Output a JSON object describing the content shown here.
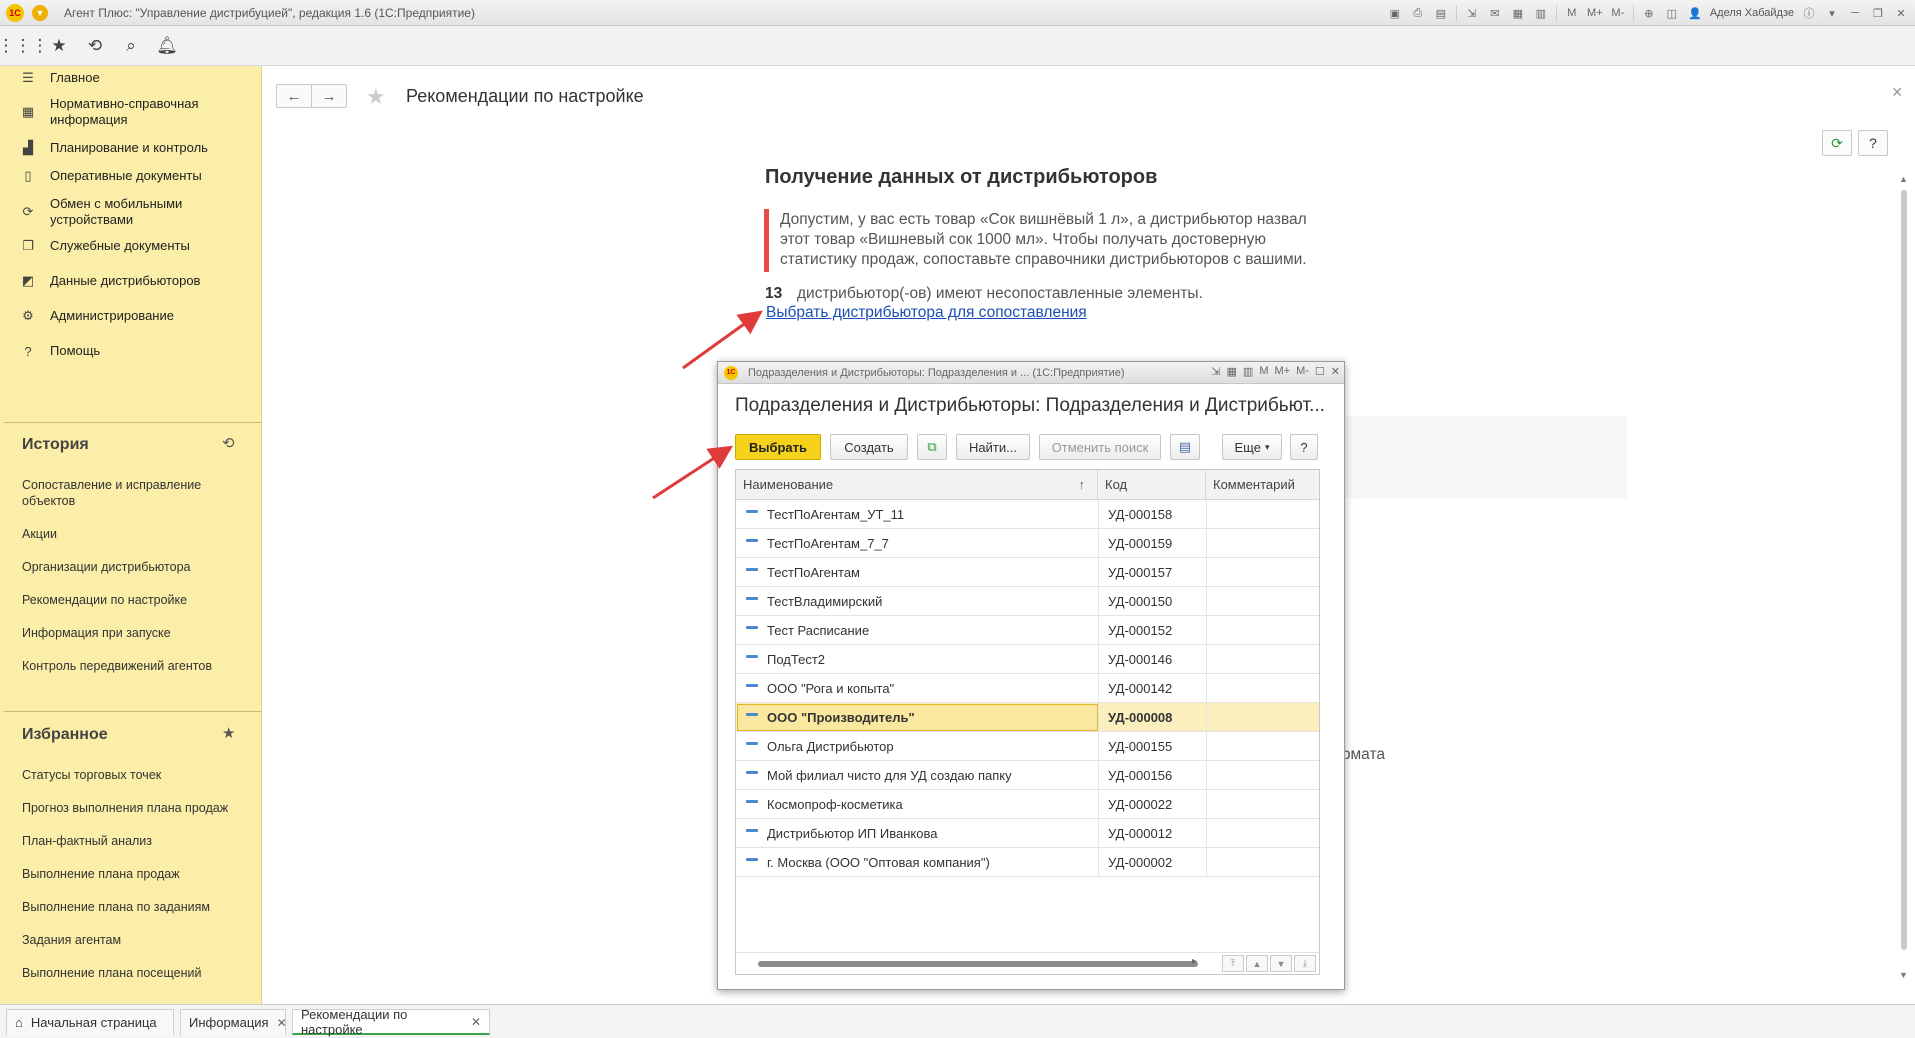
{
  "window": {
    "title": "Агент Плюс: \"Управление дистрибуцией\", редакция 1.6  (1С:Предприятие)",
    "user": "Аделя Хабайдзе",
    "logo_text": "1С"
  },
  "sidebar": {
    "items": [
      {
        "label": "Главное",
        "icon": "menu-lines-icon"
      },
      {
        "label": "Нормативно-справочная информация",
        "icon": "table-grid-icon"
      },
      {
        "label": "Планирование и контроль",
        "icon": "bar-chart-icon"
      },
      {
        "label": "Оперативные документы",
        "icon": "document-icon"
      },
      {
        "label": "Обмен с мобильными устройствами",
        "icon": "sync-icon"
      },
      {
        "label": "Служебные документы",
        "icon": "documents-icon"
      },
      {
        "label": "Данные дистрибьюторов",
        "icon": "distributor-chart-icon"
      },
      {
        "label": "Администрирование",
        "icon": "gear-icon"
      },
      {
        "label": "Помощь",
        "icon": "help-icon"
      }
    ],
    "history": {
      "title": "История",
      "links": [
        "Сопоставление и исправление объектов",
        "Акции",
        "Организации дистрибьютора",
        "Рекомендации по настройке",
        "Информация при запуске",
        "Контроль передвижений агентов"
      ]
    },
    "favorites": {
      "title": "Избранное",
      "links": [
        "Статусы торговых точек",
        "Прогноз выполнения плана продаж",
        "План-фактный анализ",
        "Выполнение плана продаж",
        "Выполнение плана по заданиям",
        "Задания агентам",
        "Выполнение плана посещений"
      ]
    }
  },
  "main": {
    "page_title": "Рекомендации по настройке",
    "section_title": "Получение данных от дистрибьюторов",
    "quote": "Допустим, у вас есть товар «Сок вишнёвый 1 л», а дистрибьютор назвал этот товар «Вишневый сок 1000 мл». Чтобы получать достоверную статистику продаж, сопоставьте справочники дистрибьюторов с вашими.",
    "count": "13",
    "count_text": "дистрибьютор(-ов) имеют несопоставленные элементы.",
    "choose_link": "Выбрать дистрибьютора для сопоставления",
    "ghost_text": "рмата",
    "help_label": "?"
  },
  "dialog": {
    "window_title": "Подразделения и Дистрибьюторы: Подразделения и ...  (1С:Предприятие)",
    "heading": "Подразделения и Дистрибьюторы: Подразделения и Дистрибьют...",
    "buttons": {
      "select": "Выбрать",
      "create": "Создать",
      "find": "Найти...",
      "cancel_search": "Отменить поиск",
      "more": "Еще",
      "help": "?"
    },
    "columns": [
      "Наименование",
      "Код",
      "Комментарий"
    ],
    "rows": [
      {
        "name": "ТестПоАгентам_УТ_11",
        "code": "УД-000158",
        "selected": false
      },
      {
        "name": "ТестПоАгентам_7_7",
        "code": "УД-000159",
        "selected": false
      },
      {
        "name": "ТестПоАгентам",
        "code": "УД-000157",
        "selected": false
      },
      {
        "name": "ТестВладимирский",
        "code": "УД-000150",
        "selected": false
      },
      {
        "name": "Тест Расписание",
        "code": "УД-000152",
        "selected": false
      },
      {
        "name": "ПодТест2",
        "code": "УД-000146",
        "selected": false
      },
      {
        "name": "ООО \"Рога и копыта\"",
        "code": "УД-000142",
        "selected": false
      },
      {
        "name": "ООО \"Производитель\"",
        "code": "УД-000008",
        "selected": true
      },
      {
        "name": "Ольга Дистрибьютор",
        "code": "УД-000155",
        "selected": false
      },
      {
        "name": "Мой филиал чисто для УД создаю папку",
        "code": "УД-000156",
        "selected": false
      },
      {
        "name": "Космопроф-косметика",
        "code": "УД-000022",
        "selected": false
      },
      {
        "name": "Дистрибьютор ИП Иванкова",
        "code": "УД-000012",
        "selected": false
      },
      {
        "name": "г. Москва  (ООО \"Оптовая компания\")",
        "code": "УД-000002",
        "selected": false
      }
    ]
  },
  "tabs": [
    {
      "label": "Начальная страница",
      "closable": false,
      "active": false
    },
    {
      "label": "Информация",
      "closable": true,
      "active": false
    },
    {
      "label": "Рекомендации по настройке",
      "closable": true,
      "active": true
    }
  ],
  "colors": {
    "sidebar_bg": "#fbeea8",
    "primary_button": "#f7d21a",
    "link": "#1a4fb5",
    "quote_bar": "#e84a4a",
    "arrow": "#e03a3a",
    "selected_row": "#fbefbd"
  }
}
